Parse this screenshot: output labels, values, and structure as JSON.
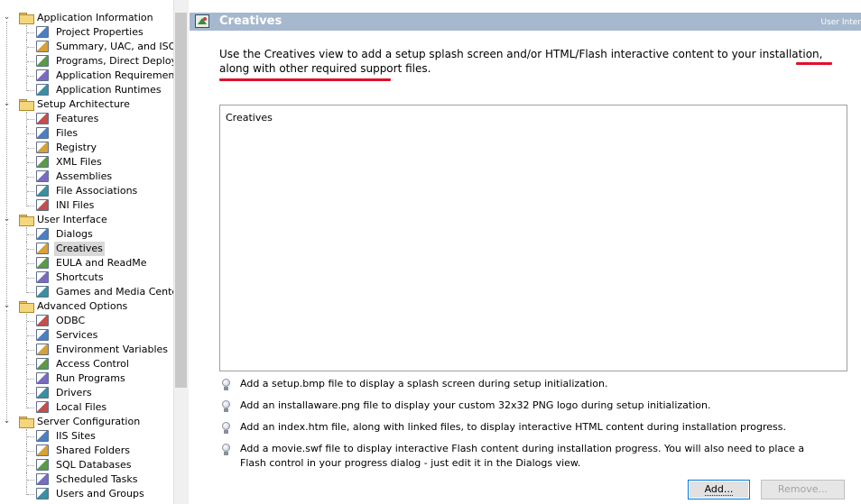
{
  "tree": {
    "groups": [
      {
        "label": "Application Information",
        "expander": "⌄",
        "items": [
          {
            "label": "Project Properties",
            "icon": "project-properties-icon"
          },
          {
            "label": "Summary, UAC, and ISO",
            "icon": "summary-icon"
          },
          {
            "label": "Programs, Direct Deploy",
            "icon": "programs-icon"
          },
          {
            "label": "Application Requirements",
            "icon": "requirements-icon"
          },
          {
            "label": "Application Runtimes",
            "icon": "runtimes-icon"
          }
        ]
      },
      {
        "label": "Setup Architecture",
        "expander": "⌄",
        "items": [
          {
            "label": "Features",
            "icon": "features-icon"
          },
          {
            "label": "Files",
            "icon": "files-icon"
          },
          {
            "label": "Registry",
            "icon": "registry-icon"
          },
          {
            "label": "XML Files",
            "icon": "xml-files-icon"
          },
          {
            "label": "Assemblies",
            "icon": "assemblies-icon"
          },
          {
            "label": "File Associations",
            "icon": "file-associations-icon"
          },
          {
            "label": "INI Files",
            "icon": "ini-files-icon"
          }
        ]
      },
      {
        "label": "User Interface",
        "expander": "⌄",
        "items": [
          {
            "label": "Dialogs",
            "icon": "dialogs-icon"
          },
          {
            "label": "Creatives",
            "icon": "creatives-icon",
            "selected": true
          },
          {
            "label": "EULA and ReadMe",
            "icon": "eula-icon"
          },
          {
            "label": "Shortcuts",
            "icon": "shortcuts-icon"
          },
          {
            "label": "Games and Media Center",
            "icon": "games-icon"
          }
        ]
      },
      {
        "label": "Advanced Options",
        "expander": "⌄",
        "items": [
          {
            "label": "ODBC",
            "icon": "odbc-icon"
          },
          {
            "label": "Services",
            "icon": "services-icon"
          },
          {
            "label": "Environment Variables",
            "icon": "environment-variables-icon"
          },
          {
            "label": "Access Control",
            "icon": "access-control-icon"
          },
          {
            "label": "Run Programs",
            "icon": "run-programs-icon"
          },
          {
            "label": "Drivers",
            "icon": "drivers-icon"
          },
          {
            "label": "Local Files",
            "icon": "local-files-icon"
          }
        ]
      },
      {
        "label": "Server Configuration",
        "expander": "⌄",
        "items": [
          {
            "label": "IIS Sites",
            "icon": "iis-sites-icon"
          },
          {
            "label": "Shared Folders",
            "icon": "shared-folders-icon"
          },
          {
            "label": "SQL Databases",
            "icon": "sql-databases-icon"
          },
          {
            "label": "Scheduled Tasks",
            "icon": "scheduled-tasks-icon"
          },
          {
            "label": "Users and Groups",
            "icon": "users-groups-icon"
          }
        ]
      }
    ]
  },
  "panel": {
    "title": "Creatives",
    "subtitle": "User Inter",
    "description": "Use the Creatives view to add a setup splash screen and/or HTML/Flash interactive content to your installation, along with other required support files.",
    "listbox_label": "Creatives",
    "tips": [
      "Add a setup.bmp file to display a splash screen during setup initialization.",
      "Add an installaware.png file to display your custom 32x32 PNG logo during setup initialization.",
      "Add an index.htm file, along with linked files, to display interactive HTML content during installation progress.",
      "Add a movie.swf file to display interactive Flash content during installation progress. You will also need to place a Flash control in your progress dialog - just edit it in the Dialogs view."
    ],
    "add_button": "Add...",
    "remove_button": "Remove..."
  },
  "colors": {
    "header_bg": "#a6b8ce",
    "annotation": "#e0102a",
    "add_button_border": "#0078d7"
  }
}
